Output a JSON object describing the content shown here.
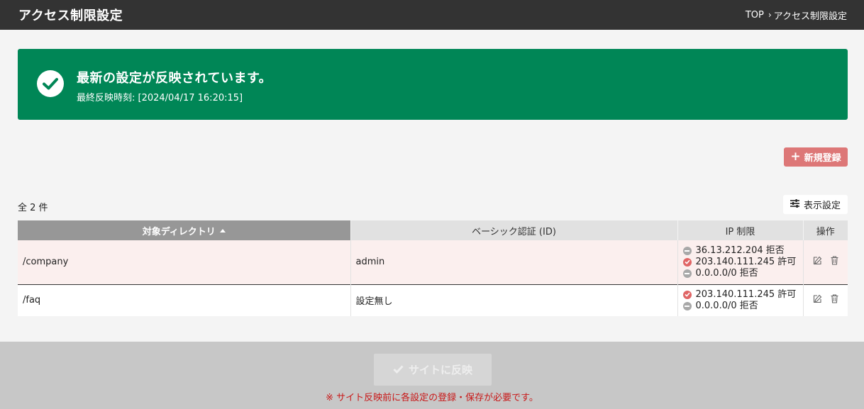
{
  "header": {
    "title": "アクセス制限設定",
    "breadcrumb": {
      "top": "TOP",
      "separator": "›",
      "current": "アクセス制限設定"
    }
  },
  "banner": {
    "message": "最新の設定が反映されています。",
    "last_applied": "最終反映時刻: [2024/04/17 16:20:15]",
    "color": "#008656"
  },
  "toolbar": {
    "new_label": "新規登録",
    "new_icon": "plus-icon",
    "count_label": "全 2 件",
    "display_settings_label": "表示設定",
    "display_settings_icon": "sliders-icon"
  },
  "table": {
    "columns": [
      "対象ディレクトリ",
      "ベーシック認証 (ID)",
      "IP 制限",
      "操作"
    ],
    "sorted_column": "対象ディレクトリ",
    "rows": [
      {
        "directory": "/company",
        "basic_auth": "admin",
        "ip_rules": [
          {
            "text": "36.13.212.204 拒否",
            "status": "deny"
          },
          {
            "text": "203.140.111.245 許可",
            "status": "allow"
          },
          {
            "text": "0.0.0.0/0 拒否",
            "status": "deny"
          }
        ]
      },
      {
        "directory": "/faq",
        "basic_auth": "設定無し",
        "ip_rules": [
          {
            "text": "203.140.111.245 許可",
            "status": "allow"
          },
          {
            "text": "0.0.0.0/0 拒否",
            "status": "deny"
          }
        ]
      }
    ]
  },
  "footer": {
    "reflect_label": "サイトに反映",
    "warning": "※ サイト反映前に各設定の登録・保存が必要です。"
  },
  "colors": {
    "accent": "#dd7777",
    "warning": "#c81818",
    "allow": "#e06565",
    "deny": "#a8a8a8"
  }
}
